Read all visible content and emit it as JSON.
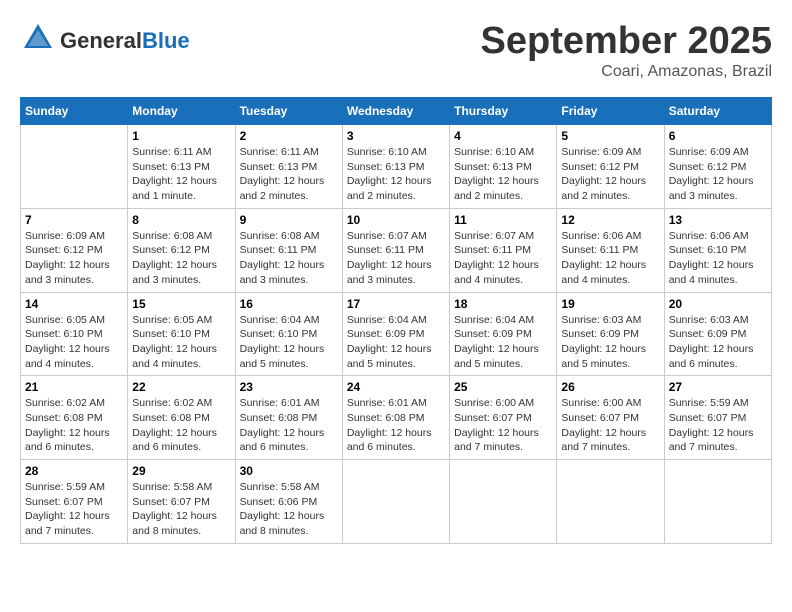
{
  "header": {
    "logo": {
      "text_general": "General",
      "text_blue": "Blue"
    },
    "month": "September 2025",
    "location": "Coari, Amazonas, Brazil"
  },
  "days_of_week": [
    "Sunday",
    "Monday",
    "Tuesday",
    "Wednesday",
    "Thursday",
    "Friday",
    "Saturday"
  ],
  "weeks": [
    [
      {
        "day": "",
        "info": ""
      },
      {
        "day": "1",
        "info": "Sunrise: 6:11 AM\nSunset: 6:13 PM\nDaylight: 12 hours\nand 1 minute."
      },
      {
        "day": "2",
        "info": "Sunrise: 6:11 AM\nSunset: 6:13 PM\nDaylight: 12 hours\nand 2 minutes."
      },
      {
        "day": "3",
        "info": "Sunrise: 6:10 AM\nSunset: 6:13 PM\nDaylight: 12 hours\nand 2 minutes."
      },
      {
        "day": "4",
        "info": "Sunrise: 6:10 AM\nSunset: 6:13 PM\nDaylight: 12 hours\nand 2 minutes."
      },
      {
        "day": "5",
        "info": "Sunrise: 6:09 AM\nSunset: 6:12 PM\nDaylight: 12 hours\nand 2 minutes."
      },
      {
        "day": "6",
        "info": "Sunrise: 6:09 AM\nSunset: 6:12 PM\nDaylight: 12 hours\nand 3 minutes."
      }
    ],
    [
      {
        "day": "7",
        "info": "Sunrise: 6:09 AM\nSunset: 6:12 PM\nDaylight: 12 hours\nand 3 minutes."
      },
      {
        "day": "8",
        "info": "Sunrise: 6:08 AM\nSunset: 6:12 PM\nDaylight: 12 hours\nand 3 minutes."
      },
      {
        "day": "9",
        "info": "Sunrise: 6:08 AM\nSunset: 6:11 PM\nDaylight: 12 hours\nand 3 minutes."
      },
      {
        "day": "10",
        "info": "Sunrise: 6:07 AM\nSunset: 6:11 PM\nDaylight: 12 hours\nand 3 minutes."
      },
      {
        "day": "11",
        "info": "Sunrise: 6:07 AM\nSunset: 6:11 PM\nDaylight: 12 hours\nand 4 minutes."
      },
      {
        "day": "12",
        "info": "Sunrise: 6:06 AM\nSunset: 6:11 PM\nDaylight: 12 hours\nand 4 minutes."
      },
      {
        "day": "13",
        "info": "Sunrise: 6:06 AM\nSunset: 6:10 PM\nDaylight: 12 hours\nand 4 minutes."
      }
    ],
    [
      {
        "day": "14",
        "info": "Sunrise: 6:05 AM\nSunset: 6:10 PM\nDaylight: 12 hours\nand 4 minutes."
      },
      {
        "day": "15",
        "info": "Sunrise: 6:05 AM\nSunset: 6:10 PM\nDaylight: 12 hours\nand 4 minutes."
      },
      {
        "day": "16",
        "info": "Sunrise: 6:04 AM\nSunset: 6:10 PM\nDaylight: 12 hours\nand 5 minutes."
      },
      {
        "day": "17",
        "info": "Sunrise: 6:04 AM\nSunset: 6:09 PM\nDaylight: 12 hours\nand 5 minutes."
      },
      {
        "day": "18",
        "info": "Sunrise: 6:04 AM\nSunset: 6:09 PM\nDaylight: 12 hours\nand 5 minutes."
      },
      {
        "day": "19",
        "info": "Sunrise: 6:03 AM\nSunset: 6:09 PM\nDaylight: 12 hours\nand 5 minutes."
      },
      {
        "day": "20",
        "info": "Sunrise: 6:03 AM\nSunset: 6:09 PM\nDaylight: 12 hours\nand 6 minutes."
      }
    ],
    [
      {
        "day": "21",
        "info": "Sunrise: 6:02 AM\nSunset: 6:08 PM\nDaylight: 12 hours\nand 6 minutes."
      },
      {
        "day": "22",
        "info": "Sunrise: 6:02 AM\nSunset: 6:08 PM\nDaylight: 12 hours\nand 6 minutes."
      },
      {
        "day": "23",
        "info": "Sunrise: 6:01 AM\nSunset: 6:08 PM\nDaylight: 12 hours\nand 6 minutes."
      },
      {
        "day": "24",
        "info": "Sunrise: 6:01 AM\nSunset: 6:08 PM\nDaylight: 12 hours\nand 6 minutes."
      },
      {
        "day": "25",
        "info": "Sunrise: 6:00 AM\nSunset: 6:07 PM\nDaylight: 12 hours\nand 7 minutes."
      },
      {
        "day": "26",
        "info": "Sunrise: 6:00 AM\nSunset: 6:07 PM\nDaylight: 12 hours\nand 7 minutes."
      },
      {
        "day": "27",
        "info": "Sunrise: 5:59 AM\nSunset: 6:07 PM\nDaylight: 12 hours\nand 7 minutes."
      }
    ],
    [
      {
        "day": "28",
        "info": "Sunrise: 5:59 AM\nSunset: 6:07 PM\nDaylight: 12 hours\nand 7 minutes."
      },
      {
        "day": "29",
        "info": "Sunrise: 5:58 AM\nSunset: 6:07 PM\nDaylight: 12 hours\nand 8 minutes."
      },
      {
        "day": "30",
        "info": "Sunrise: 5:58 AM\nSunset: 6:06 PM\nDaylight: 12 hours\nand 8 minutes."
      },
      {
        "day": "",
        "info": ""
      },
      {
        "day": "",
        "info": ""
      },
      {
        "day": "",
        "info": ""
      },
      {
        "day": "",
        "info": ""
      }
    ]
  ]
}
